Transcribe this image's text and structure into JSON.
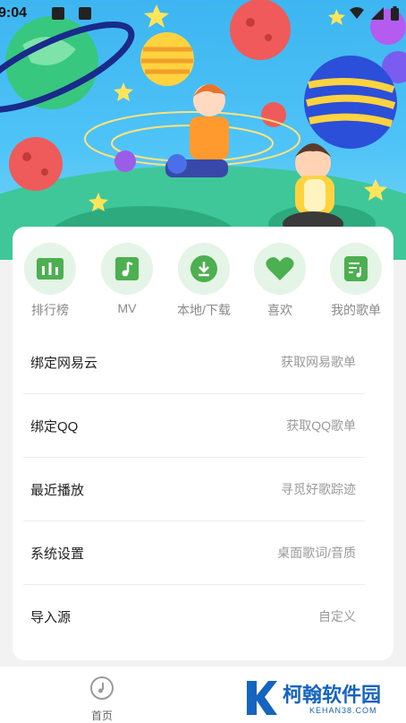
{
  "status_bar": {
    "time": "9:04"
  },
  "quick_actions": [
    {
      "label": "排行榜",
      "icon": "chart-bars-icon"
    },
    {
      "label": "MV",
      "icon": "music-note-icon"
    },
    {
      "label": "本地/下载",
      "icon": "download-icon"
    },
    {
      "label": "喜欢",
      "icon": "heart-icon"
    },
    {
      "label": "我的歌单",
      "icon": "playlist-icon"
    }
  ],
  "menu": [
    {
      "title": "绑定网易云",
      "hint": "获取网易歌单"
    },
    {
      "title": "绑定QQ",
      "hint": "获取QQ歌单"
    },
    {
      "title": "最近播放",
      "hint": "寻觅好歌踪迹"
    },
    {
      "title": "系统设置",
      "hint": "桌面歌词/音质"
    },
    {
      "title": "导入源",
      "hint": "自定义"
    }
  ],
  "tabbar": {
    "home_label": "首页"
  },
  "watermark": {
    "name": "柯翰软件园",
    "url": "KEHAN38.COM"
  },
  "colors": {
    "accent_green": "#4caf50",
    "icon_bg": "#e4f4e6",
    "hero_blue": "#4ec3f7"
  }
}
